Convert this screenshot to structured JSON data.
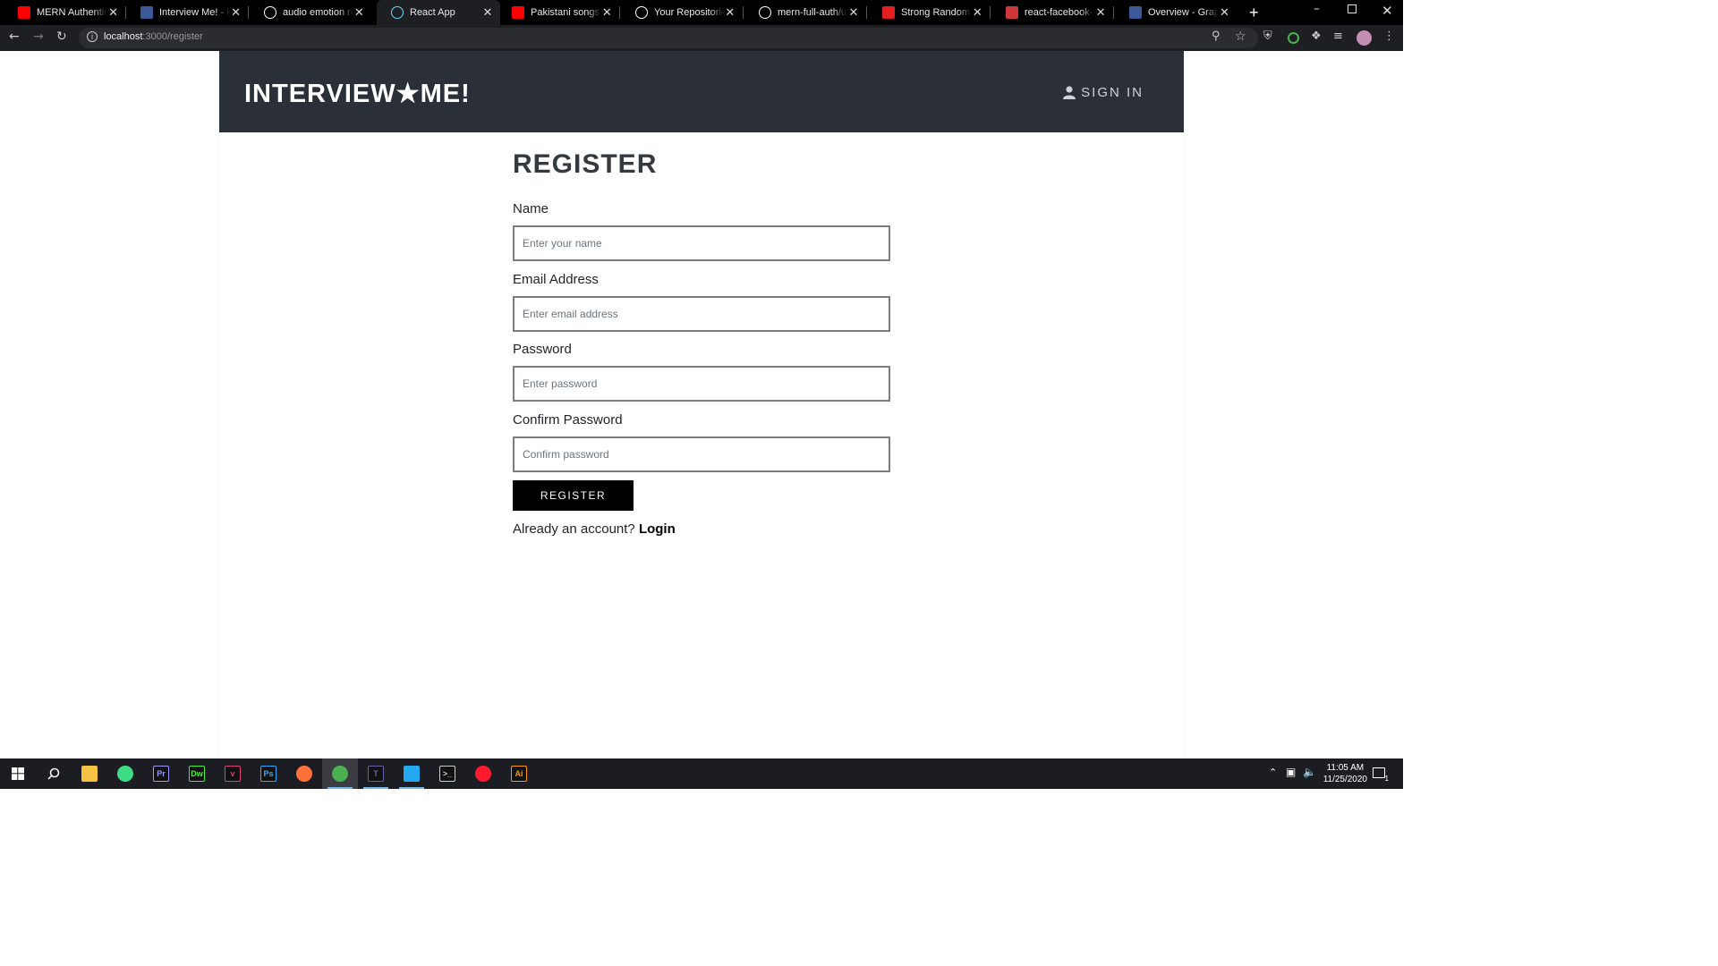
{
  "browser": {
    "tabs": [
      {
        "title": "MERN Authenticatio",
        "icon": "youtube-icon",
        "color": "#ff0000"
      },
      {
        "title": "Interview Me! - Face",
        "icon": "facebook-icon",
        "color": "#3b5998"
      },
      {
        "title": "audio emotion reco",
        "icon": "google-icon",
        "color": "#ffffff"
      },
      {
        "title": "React App",
        "icon": "react-icon",
        "color": "#61dafb"
      },
      {
        "title": "Pakistani songs to l",
        "icon": "youtube-icon",
        "color": "#ff0000"
      },
      {
        "title": "Your Repositories",
        "icon": "github-icon",
        "color": "#ffffff"
      },
      {
        "title": "mern-full-auth/use",
        "icon": "github-icon",
        "color": "#ffffff"
      },
      {
        "title": "Strong Random Pa",
        "icon": "password-generator-icon",
        "color": "#e02020"
      },
      {
        "title": "react-facebook-log",
        "icon": "npm-icon",
        "color": "#cb3837"
      },
      {
        "title": "Overview - Graph A",
        "icon": "facebook-icon",
        "color": "#3b5998"
      }
    ],
    "url_host": "localhost",
    "url_path": ":3000/register"
  },
  "app": {
    "brand": "INTERVIEW★ME!",
    "signin_label": "SIGN IN"
  },
  "form": {
    "title": "REGISTER",
    "name_label": "Name",
    "name_placeholder": "Enter your name",
    "email_label": "Email Address",
    "email_placeholder": "Enter email address",
    "password_label": "Password",
    "password_placeholder": "Enter password",
    "confirm_label": "Confirm Password",
    "confirm_placeholder": "Confirm password",
    "submit_label": "REGISTER",
    "already_text": "Already an account?",
    "login_link": "Login"
  },
  "taskbar": {
    "apps": [
      {
        "name": "file-explorer-icon",
        "text": "",
        "color": "#f5c242"
      },
      {
        "name": "gitkraken-icon",
        "text": "",
        "color": "#3ddc84"
      },
      {
        "name": "premiere-pro-icon",
        "text": "Pr",
        "color": "#9999ff"
      },
      {
        "name": "dreamweaver-icon",
        "text": "Dw",
        "color": "#4af038"
      },
      {
        "name": "vectr-icon",
        "text": "v",
        "color": "#e0407a"
      },
      {
        "name": "photoshop-icon",
        "text": "Ps",
        "color": "#31a8ff"
      },
      {
        "name": "firefox-icon",
        "text": "",
        "color": "#ff7139"
      },
      {
        "name": "chrome-icon",
        "text": "",
        "color": "#4caf50"
      },
      {
        "name": "teams-icon",
        "text": "T",
        "color": "#6264a7"
      },
      {
        "name": "vscode-icon",
        "text": "",
        "color": "#23a9f2"
      },
      {
        "name": "terminal-icon",
        "text": ">_",
        "color": "#cccccc"
      },
      {
        "name": "opera-icon",
        "text": "",
        "color": "#ff1b2d"
      },
      {
        "name": "illustrator-icon",
        "text": "Ai",
        "color": "#ff9a00"
      }
    ],
    "time": "11:05 AM",
    "date": "11/25/2020",
    "notification_count": "1"
  }
}
